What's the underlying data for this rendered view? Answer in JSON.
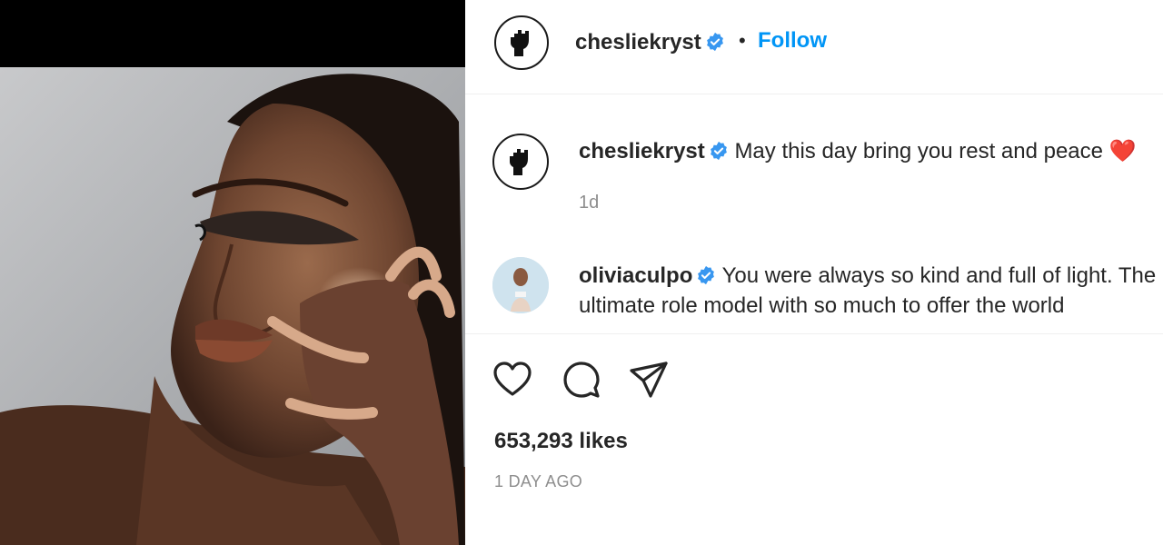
{
  "post": {
    "author": {
      "username": "chesliekryst",
      "verified": true,
      "avatar_icon": "raised-fist-icon"
    },
    "separator": "•",
    "follow_label": "Follow",
    "image": {
      "subject": "portrait-photo"
    }
  },
  "comments": [
    {
      "username": "chesliekryst",
      "verified": true,
      "text": "May this day bring you rest and peace ❤️",
      "time": "1d",
      "avatar_icon": "raised-fist-icon"
    },
    {
      "username": "oliviaculpo",
      "verified": true,
      "text": "You were always so kind and full of light. The ultimate role model with so much to offer the world",
      "avatar_icon": "profile-photo"
    }
  ],
  "actions": {
    "like_icon": "heart-icon",
    "comment_icon": "comment-icon",
    "share_icon": "paper-plane-icon"
  },
  "likes_text": "653,293 likes",
  "timestamp_text": "1 DAY AGO",
  "colors": {
    "link_blue": "#0095f6",
    "verified_blue": "#3897f0",
    "secondary_text": "#8e8e8e",
    "divider": "#efefef"
  }
}
